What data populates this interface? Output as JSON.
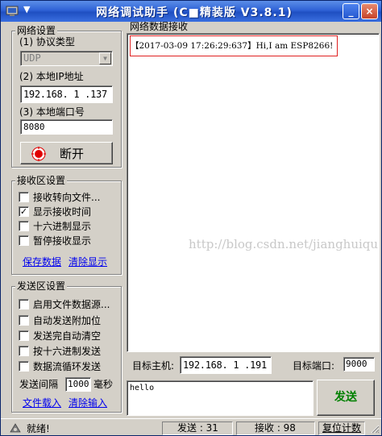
{
  "window": {
    "title": "网络调试助手 (C■精装版 V3.8.1)",
    "sys_menu": "▼",
    "min_label": "_",
    "close_label": "×"
  },
  "net_settings": {
    "title": "网络设置",
    "protocol_label": "(1) 协议类型",
    "protocol_value": "UDP",
    "local_ip_label": "(2) 本地IP地址",
    "local_ip_value": "192.168. 1 .137",
    "local_port_label": "(3) 本地端口号",
    "local_port_value": "8080",
    "disconnect_label": "断开"
  },
  "recv_settings": {
    "title": "接收区设置",
    "options": [
      {
        "label": "接收转向文件...",
        "checked": false
      },
      {
        "label": "显示接收时间",
        "checked": true
      },
      {
        "label": "十六进制显示",
        "checked": false
      },
      {
        "label": "暂停接收显示",
        "checked": false
      }
    ],
    "save_data": "保存数据",
    "clear_display": "清除显示"
  },
  "send_settings": {
    "title": "发送区设置",
    "options": [
      {
        "label": "启用文件数据源...",
        "checked": false
      },
      {
        "label": "自动发送附加位",
        "checked": false
      },
      {
        "label": "发送完自动清空",
        "checked": false
      },
      {
        "label": "按十六进制发送",
        "checked": false
      },
      {
        "label": "数据流循环发送",
        "checked": false
      }
    ],
    "interval_label": "发送间隔",
    "interval_value": "1000",
    "interval_unit": "毫秒",
    "load_file": "文件载入",
    "clear_input": "清除输入"
  },
  "recv_area": {
    "title": "网络数据接收",
    "lines": [
      "【2017-03-09 17:26:29:637】Hi,I am ESP8266!"
    ],
    "watermark": "http://blog.csdn.net/jianghuiquan"
  },
  "target": {
    "host_label": "目标主机:",
    "host_value": "192.168. 1 .191",
    "port_label": "目标端口:",
    "port_value": "9000"
  },
  "send_area": {
    "text": "hello",
    "send_button": "发送"
  },
  "status": {
    "ready": "就绪!",
    "sent_label": "发送 : 31",
    "recv_label": "接收 : 98",
    "reset_label": "复位计数"
  },
  "colors": {
    "title_bar": "#2f62d6",
    "highlight_border": "#e02020",
    "link": "#0000ee",
    "send_button_text": "#008000",
    "record_icon": "#e00000"
  }
}
